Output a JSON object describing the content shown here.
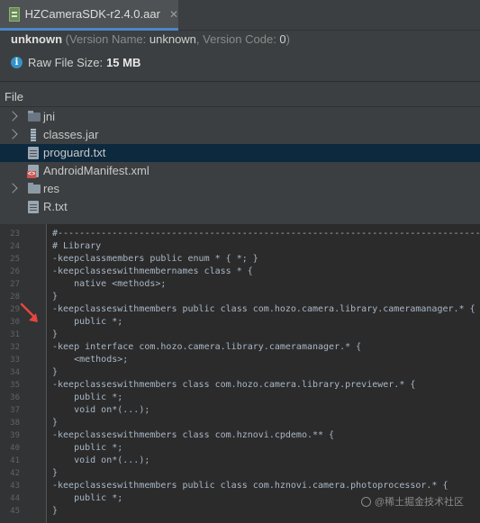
{
  "tab": {
    "title": "HZCameraSDK-r2.4.0.aar",
    "close": "✕"
  },
  "info": {
    "app_name": "unknown",
    "version_label_open": " (Version Name: ",
    "version_name": "unknown",
    "version_code_label": ", Version Code: ",
    "version_code": "0",
    "close_paren": ")"
  },
  "size": {
    "label": "Raw File Size:",
    "value": "15 MB"
  },
  "tree": {
    "header": "File",
    "items": [
      {
        "label": "jni",
        "icon": "folder-icon",
        "expandable": true
      },
      {
        "label": "classes.jar",
        "icon": "jar-icon",
        "expandable": true
      },
      {
        "label": "proguard.txt",
        "icon": "text-file-icon",
        "expandable": false,
        "selected": true
      },
      {
        "label": "AndroidManifest.xml",
        "icon": "xml-file-icon",
        "expandable": false
      },
      {
        "label": "res",
        "icon": "folder-icon",
        "expandable": true
      },
      {
        "label": "R.txt",
        "icon": "text-file-icon",
        "expandable": false
      }
    ]
  },
  "editor": {
    "line_numbers": [
      "23",
      "24",
      "25",
      "26",
      "27",
      "28",
      "29",
      "30",
      "31",
      "32",
      "33",
      "34",
      "35",
      "36",
      "37",
      "38",
      "39",
      "40",
      "41",
      "42",
      "43",
      "44",
      "45"
    ],
    "lines": [
      "#--------------------------------------------------------------------------------",
      "# Library",
      "-keepclassmembers public enum * { *; }",
      "-keepclasseswithmembernames class * {",
      "    native <methods>;",
      "}",
      "-keepclasseswithmembers public class com.hozo.camera.library.cameramanager.* {",
      "    public *;",
      "}",
      "-keep interface com.hozo.camera.library.cameramanager.* {",
      "    <methods>;",
      "}",
      "-keepclasseswithmembers class com.hozo.camera.library.previewer.* {",
      "    public *;",
      "    void on*(...);",
      "}",
      "-keepclasseswithmembers class com.hznovi.cpdemo.** {",
      "    public *;",
      "    void on*(...);",
      "}",
      "-keepclasseswithmembers public class com.hznovi.camera.photoprocessor.* {",
      "    public *;",
      "}"
    ]
  },
  "watermark": "@稀土掘金技术社区",
  "colors": {
    "accent": "#4a88c7",
    "selection": "#0d293e",
    "annotation_arrow": "#e8453c"
  }
}
